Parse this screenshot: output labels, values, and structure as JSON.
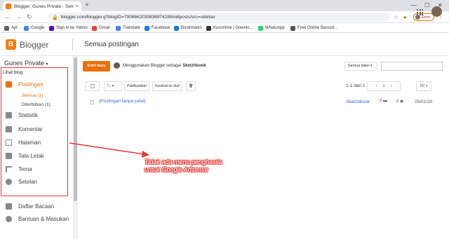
{
  "browser": {
    "tab_title": "Blogger: Gunes Private - Semua...",
    "tab_close": "×",
    "new_tab": "+",
    "window_controls": [
      "—",
      "☐",
      "✕"
    ],
    "url": "blogger.com/blogger.g?blogID=7906662030836974288#allposts/src=sidebar",
    "profile_label": "Error",
    "bookmarks": [
      {
        "label": "Apl",
        "color": "#5f6368"
      },
      {
        "label": "Google",
        "color": "#4285f4"
      },
      {
        "label": "Sign in ke Yahoo",
        "color": "#6001d2"
      },
      {
        "label": "Gmail",
        "color": "#ea4335"
      },
      {
        "label": "Translate",
        "color": "#4285f4"
      },
      {
        "label": "Facebook",
        "color": "#1877f2"
      },
      {
        "label": "Bookmarks",
        "color": "#1a73e8"
      },
      {
        "label": "Kusonime | Downlo...",
        "color": "#333333"
      },
      {
        "label": "WhatsApp",
        "color": "#25d366"
      },
      {
        "label": "Free Online Barcod...",
        "color": "#555555"
      }
    ]
  },
  "header": {
    "brand": "Blogger",
    "page_title": "Semua postingan"
  },
  "sidebar": {
    "blog_name": "Gunes Private",
    "view_blog": "Lihat blog",
    "items": [
      {
        "label": "Postingan",
        "icon": "posts-icon",
        "active": true
      },
      {
        "label": "Statistik",
        "icon": "stats-icon"
      },
      {
        "label": "Komentar",
        "icon": "comments-icon"
      },
      {
        "label": "Halaman",
        "icon": "pages-icon"
      },
      {
        "label": "Tata Letak",
        "icon": "layout-icon"
      },
      {
        "label": "Tema",
        "icon": "theme-icon"
      },
      {
        "label": "Setelan",
        "icon": "settings-icon"
      }
    ],
    "subitems": [
      {
        "label": "Semua (1)",
        "selected": true
      },
      {
        "label": "Diterbitkan (1)"
      }
    ],
    "footer_items": [
      {
        "label": "Daftar Bacaan",
        "icon": "reading-list-icon"
      },
      {
        "label": "Bantuan & Masukan",
        "icon": "help-icon"
      }
    ]
  },
  "main": {
    "new_post": "Entri baru",
    "using_prefix": "Menggunakan Blogger sebagai",
    "using_account": "Sketzhbook",
    "label_filter": "Semua label",
    "toolbar": {
      "publish": "Publikasikan",
      "revert": "Kembali ke draf"
    },
    "pager_text": "1-1 dari 1",
    "page_number": "1",
    "page_size": "50",
    "posts": [
      {
        "title": "(Postingan tanpa judul)",
        "author": "Sketzhbook",
        "comments": "0",
        "views": "0",
        "date": "25/02/20"
      }
    ]
  },
  "annotation": {
    "line1": "Tidak ada menu penghasila",
    "line2": "untuk Google Adsense",
    "color": "#e53935"
  }
}
